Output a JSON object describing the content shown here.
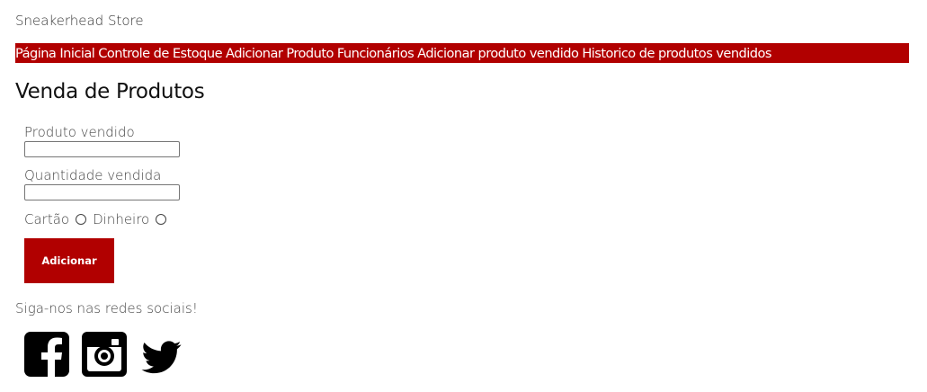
{
  "brand": "Sneakerhead Store",
  "nav": {
    "items": [
      "Página Inicial",
      "Controle de Estoque",
      "Adicionar Produto",
      "Funcionários",
      "Adicionar produto vendido",
      "Historico de produtos vendidos"
    ]
  },
  "page_title": "Venda de Produtos",
  "form": {
    "product_label": "Produto vendido",
    "product_value": "",
    "quantity_label": "Quantidade vendida",
    "quantity_value": "",
    "payment_options": [
      "Cartão",
      "Dinheiro"
    ],
    "submit_label": "Adicionar"
  },
  "social": {
    "heading": "Siga-nos nas redes sociais!",
    "icons": [
      "facebook-icon",
      "instagram-icon",
      "twitter-icon"
    ]
  },
  "colors": {
    "accent": "#b10000"
  }
}
